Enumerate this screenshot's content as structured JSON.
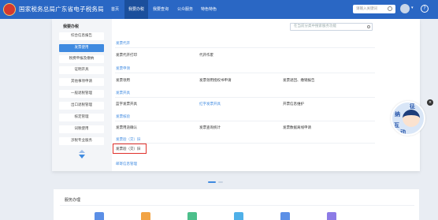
{
  "header": {
    "brand": "国家税务总局广东省电子税务局",
    "nav": [
      "首页",
      "我要办税",
      "我要查询",
      "公众服务",
      "特色特色"
    ],
    "search_placeholder": "请输入关键词",
    "help": "?"
  },
  "sidebar": {
    "title": "我要办税",
    "items": [
      {
        "label": "综合信息报告",
        "active": false
      },
      {
        "label": "发票使用",
        "active": true
      },
      {
        "label": "税费申报及缴纳",
        "active": false
      },
      {
        "label": "证明开具",
        "active": false
      },
      {
        "label": "其他事项申请",
        "active": false
      },
      {
        "label": "一般退税管理",
        "active": false
      },
      {
        "label": "出口退税管理",
        "active": false
      },
      {
        "label": "核定管理",
        "active": false
      },
      {
        "label": "词税使用",
        "active": false
      },
      {
        "label": "涉税专业服务",
        "active": false
      }
    ]
  },
  "panel": {
    "search_placeholder": "在当前分类中搜索服务功能",
    "categories": [
      {
        "title": "发票代开",
        "links": [
          "发票代开打印",
          "代开作废"
        ]
      },
      {
        "title": "发票申领",
        "links": [
          "发票领用",
          "发票领用授权书申请",
          "发票退回、缴销报告"
        ]
      },
      {
        "title": "发票开具",
        "links": [
          "蓝字发票开具",
          "红字发票开具",
          "开票信息维护"
        ]
      },
      {
        "title": "发票核验",
        "links": [
          "发票用途确认",
          "发票查询统计",
          "发票数据离线申请"
        ]
      },
      {
        "title": "发票验（交）旧",
        "links": [
          "发票验（交）旧"
        ]
      },
      {
        "title": "邮寄信息管理",
        "links": []
      }
    ]
  },
  "mascot": {
    "chars": [
      "征",
      "纳",
      "互",
      "动"
    ],
    "close": "×"
  },
  "section": {
    "title": "服务办理"
  },
  "colors": {
    "primary": "#2a67c4",
    "accent": "#3f8ae0",
    "highlight": "#e0302a"
  }
}
